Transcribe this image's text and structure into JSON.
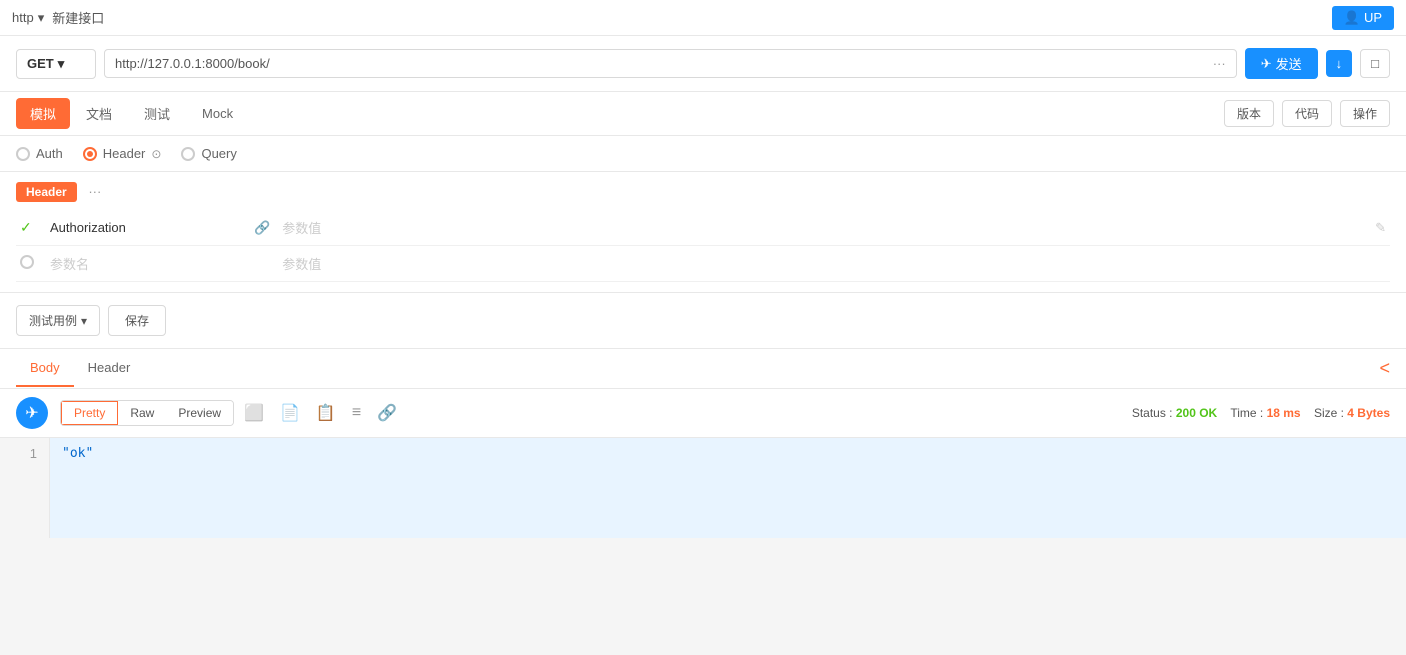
{
  "topbar": {
    "protocol": "http",
    "protocol_arrow": "▾",
    "title": "新建接口",
    "user_label": "UP"
  },
  "urlbar": {
    "method": "GET",
    "method_arrow": "▾",
    "url": "http://127.0.0.1:8000/book/",
    "dots_icon": "···",
    "send_label": "发送",
    "send_icon": "▷",
    "download_icon": "↓",
    "save_doc_icon": "□"
  },
  "tabs": {
    "items": [
      {
        "label": "模拟",
        "active": true
      },
      {
        "label": "文档",
        "active": false
      },
      {
        "label": "测试",
        "active": false
      },
      {
        "label": "Mock",
        "active": false
      }
    ],
    "toolbar_version": "版本",
    "toolbar_code": "代码",
    "toolbar_ops": "操作"
  },
  "params": {
    "auth_label": "Auth",
    "header_label": "Header",
    "header_active": true,
    "shield_icon": "⊙",
    "query_label": "Query"
  },
  "header_section": {
    "label": "Header",
    "dots": "···",
    "rows": [
      {
        "checked": true,
        "name": "Authorization",
        "link_icon": "🔗",
        "value_placeholder": "参数值",
        "edit_icon": "✎"
      },
      {
        "checked": false,
        "name_placeholder": "参数名",
        "link_icon": "",
        "value_placeholder": "参数值",
        "edit_icon": ""
      }
    ]
  },
  "actions": {
    "test_example": "测试用例",
    "test_arrow": "▾",
    "save_label": "保存"
  },
  "response": {
    "tabs": [
      {
        "label": "Body",
        "active": true
      },
      {
        "label": "Header",
        "active": false
      }
    ],
    "collapse_icon": "<",
    "format_buttons": [
      {
        "label": "Pretty",
        "active": true
      },
      {
        "label": "Raw",
        "active": false
      },
      {
        "label": "Preview",
        "active": false
      }
    ],
    "tool_icons": [
      "□",
      "□",
      "□",
      "≡",
      "🔗"
    ],
    "status_label": "Status :",
    "status_value": "200 OK",
    "time_label": "Time :",
    "time_value": "18 ms",
    "size_label": "Size :",
    "size_value": "4 Bytes",
    "line_numbers": [
      "1"
    ],
    "code_line": "\"ok\""
  }
}
